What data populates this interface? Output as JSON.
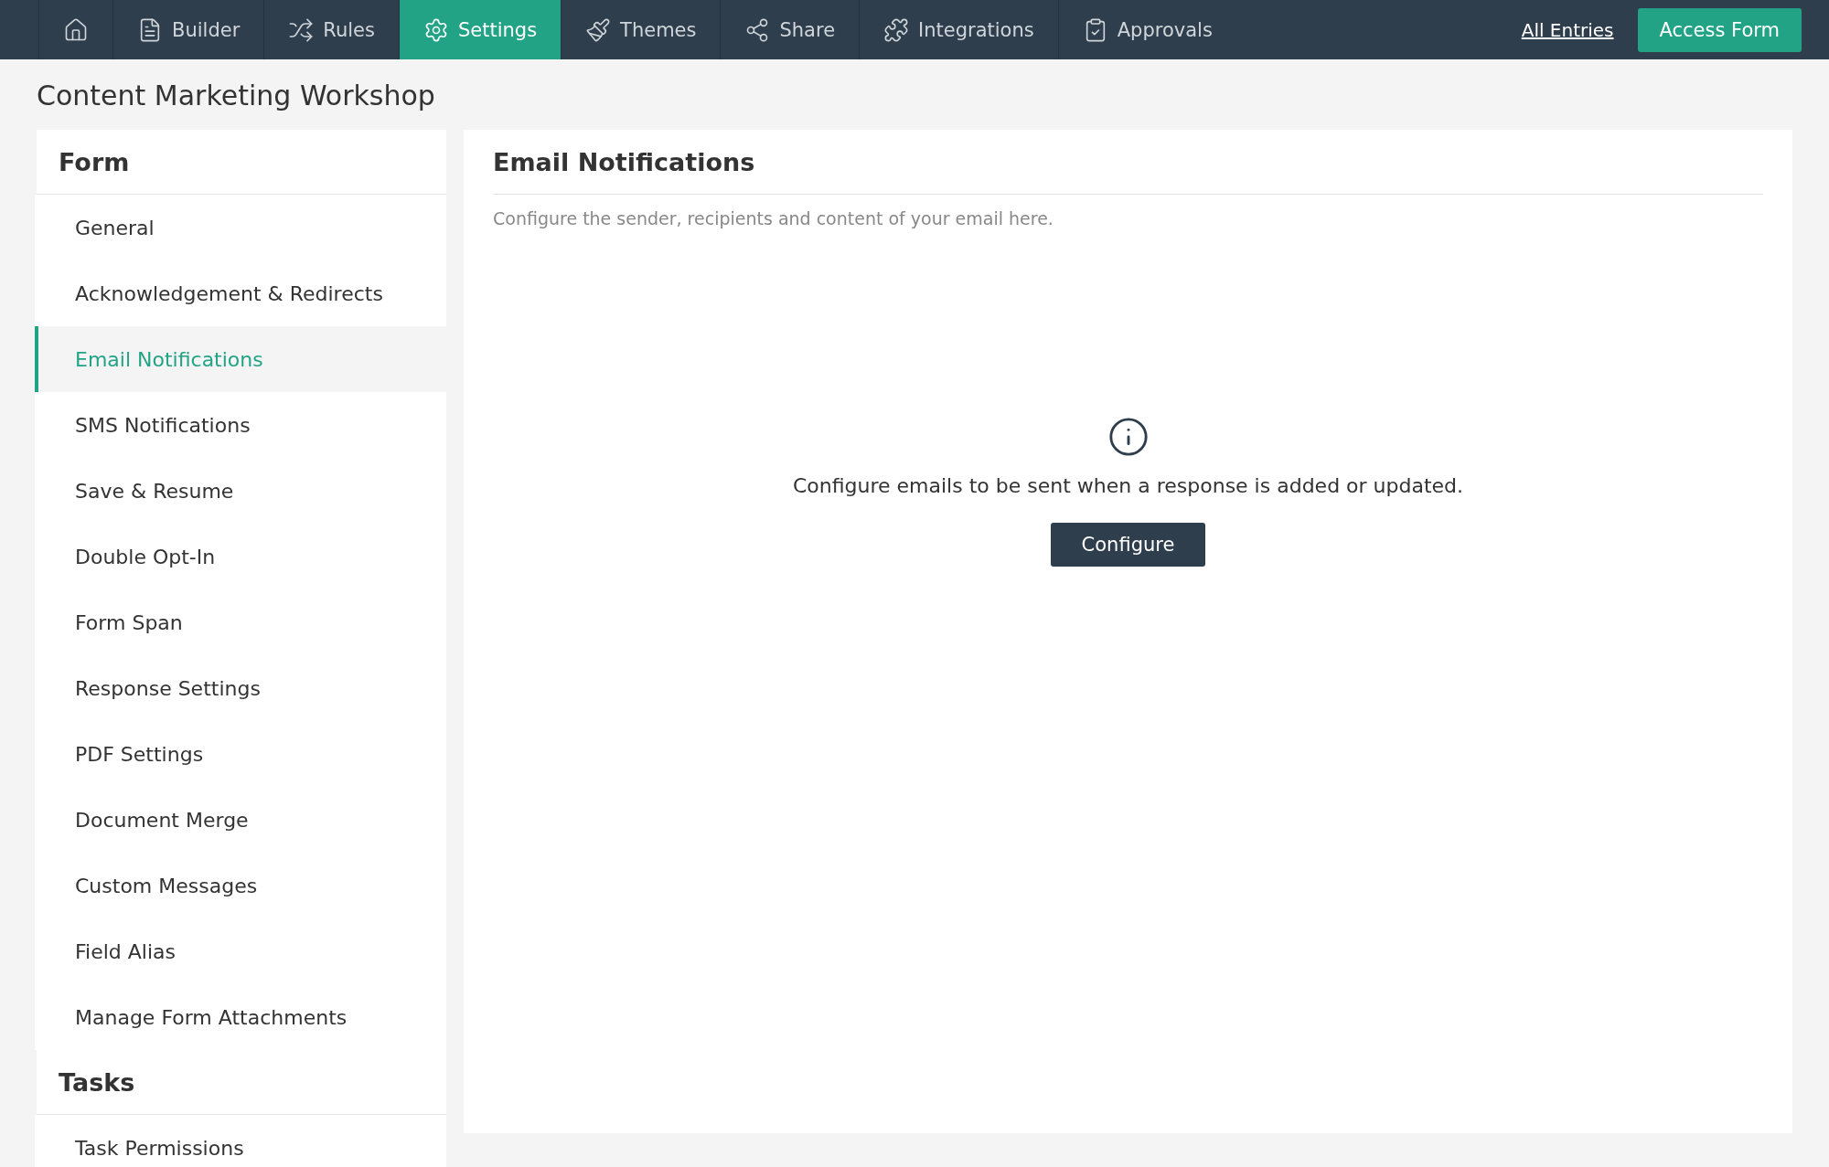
{
  "nav": {
    "tabs": [
      {
        "kind": "home",
        "selected": false
      },
      {
        "kind": "builder",
        "label": "Builder",
        "selected": false
      },
      {
        "kind": "rules",
        "label": "Rules",
        "selected": false
      },
      {
        "kind": "settings",
        "label": "Settings",
        "selected": true
      },
      {
        "kind": "themes",
        "label": "Themes",
        "selected": false
      },
      {
        "kind": "share",
        "label": "Share",
        "selected": false
      },
      {
        "kind": "integrations",
        "label": "Integrations",
        "selected": false
      },
      {
        "kind": "approvals",
        "label": "Approvals",
        "selected": false
      }
    ],
    "link": "All Entries",
    "button": "Access Form"
  },
  "page_title": "Content Marketing Workshop",
  "sidebar": {
    "sections": [
      {
        "title": "Form",
        "items": [
          {
            "label": "General",
            "selected": false
          },
          {
            "label": "Acknowledgement & Redirects",
            "selected": false
          },
          {
            "label": "Email Notifications",
            "selected": true
          },
          {
            "label": "SMS Notifications",
            "selected": false
          },
          {
            "label": "Save & Resume",
            "selected": false
          },
          {
            "label": "Double Opt-In",
            "selected": false
          },
          {
            "label": "Form Span",
            "selected": false
          },
          {
            "label": "Response Settings",
            "selected": false
          },
          {
            "label": "PDF Settings",
            "selected": false
          },
          {
            "label": "Document Merge",
            "selected": false
          },
          {
            "label": "Custom Messages",
            "selected": false
          },
          {
            "label": "Field Alias",
            "selected": false
          },
          {
            "label": "Manage Form Attachments",
            "selected": false
          }
        ]
      },
      {
        "title": "Tasks",
        "items": [
          {
            "label": "Task Permissions",
            "selected": false
          }
        ]
      }
    ]
  },
  "panel": {
    "title": "Email Notifications",
    "subtitle": "Configure the sender, recipients and content of your email here.",
    "empty_message": "Configure emails to be sent when a response is added or updated.",
    "button": "Configure"
  }
}
